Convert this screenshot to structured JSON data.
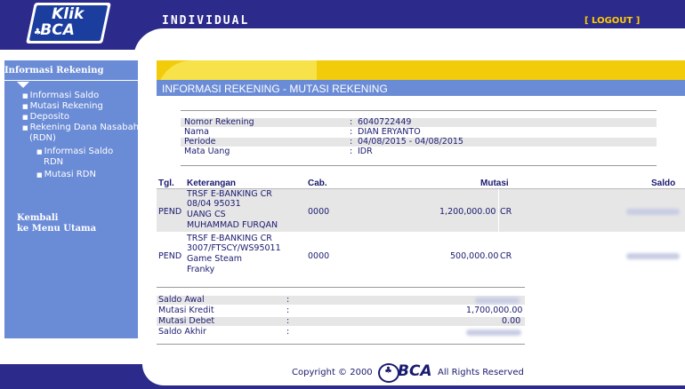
{
  "header": {
    "logo_line1": "Klik",
    "logo_line2": "BCA",
    "section_title": "INDIVIDUAL",
    "logout_label": "[ LOGOUT ]"
  },
  "sidebar": {
    "title": "Informasi Rekening",
    "items": [
      {
        "label": "Informasi Saldo"
      },
      {
        "label": "Mutasi Rekening"
      },
      {
        "label": "Deposito"
      },
      {
        "label": "Rekening Dana Nasabah"
      },
      {
        "label": "(RDN)"
      }
    ],
    "subitems": [
      {
        "label": "Informasi Saldo"
      },
      {
        "label": "RDN"
      },
      {
        "label": "Mutasi RDN"
      }
    ],
    "back_line1": "Kembali",
    "back_line2": "ke Menu Utama"
  },
  "main": {
    "page_title": "INFORMASI REKENING - MUTASI REKENING",
    "account_info": [
      {
        "label": "Nomor Rekening",
        "value": "6040722449"
      },
      {
        "label": "Nama",
        "value": "DIAN ERYANTO"
      },
      {
        "label": "Periode",
        "value": "04/08/2015 - 04/08/2015"
      },
      {
        "label": "Mata Uang",
        "value": "IDR"
      }
    ],
    "colon": ":",
    "table_headers": {
      "date": "Tgl.",
      "description": "Keterangan",
      "branch": "Cab.",
      "mutation": "Mutasi",
      "balance": "Saldo"
    },
    "transactions": [
      {
        "date": "PEND",
        "description": [
          "TRSF E-BANKING CR",
          "08/04 95031",
          "UANG CS",
          "MUHAMMAD FURQAN"
        ],
        "branch": "0000",
        "amount": "1,200,000.00",
        "type": "CR"
      },
      {
        "date": "PEND",
        "description": [
          "TRSF E-BANKING CR",
          "3007/FTSCY/WS95011",
          "Game Steam",
          "Franky"
        ],
        "branch": "0000",
        "amount": "500,000.00",
        "type": "CR"
      }
    ],
    "summary": [
      {
        "label": "Saldo Awal",
        "value": ""
      },
      {
        "label": "Mutasi Kredit",
        "value": "1,700,000.00"
      },
      {
        "label": "Mutasi Debet",
        "value": "0.00"
      },
      {
        "label": "Saldo Akhir",
        "value": ""
      }
    ]
  },
  "footer": {
    "copyright": "Copyright © 2000",
    "brand": "BCA",
    "rights": "All Rights Reserved"
  },
  "colors": {
    "navy": "#2c2b8c",
    "sidebar_blue": "#6a8bd6",
    "yellow": "#f2cc0a",
    "text": "#1a1a70"
  }
}
